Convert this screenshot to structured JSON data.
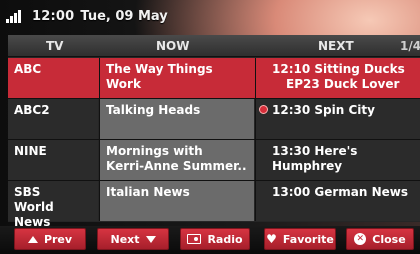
{
  "status": {
    "clock": "12:00",
    "date": "Tue, 09 May"
  },
  "header": {
    "tv": "TV",
    "now": "NOW",
    "next": "NEXT",
    "page": "1/4"
  },
  "rows": [
    {
      "channel": "ABC",
      "now": "The Way Things Work",
      "next_line1": "12:10 Sitting Ducks",
      "next_line2": "EP23 Duck Lover"
    },
    {
      "channel": "ABC2",
      "now": "Talking Heads",
      "next_line1": "12:30 Spin City"
    },
    {
      "channel": "NINE",
      "now_line1": "Mornings with",
      "now_line2": "Kerri-Anne Summer..",
      "next_line1": "13:30 Here's Humphrey"
    },
    {
      "channel_line1": "SBS",
      "channel_line2": "World News",
      "now": "Italian News",
      "next_line1": "13:00 German News"
    }
  ],
  "buttons": {
    "prev": "Prev",
    "next": "Next",
    "radio": "Radio",
    "favorite": "Favorite",
    "close": "Close"
  },
  "icons": {
    "signal": "signal-strength-icon",
    "reminder": "reminder-icon",
    "prev": "triangle-up-icon",
    "next": "triangle-down-icon",
    "radio": "radio-icon",
    "favorite": "heart-icon",
    "close": "close-circle-icon"
  },
  "colors": {
    "accent": "#c72b38",
    "now_column": "#6b6b6b",
    "row_bg": "#2b2b2b"
  }
}
